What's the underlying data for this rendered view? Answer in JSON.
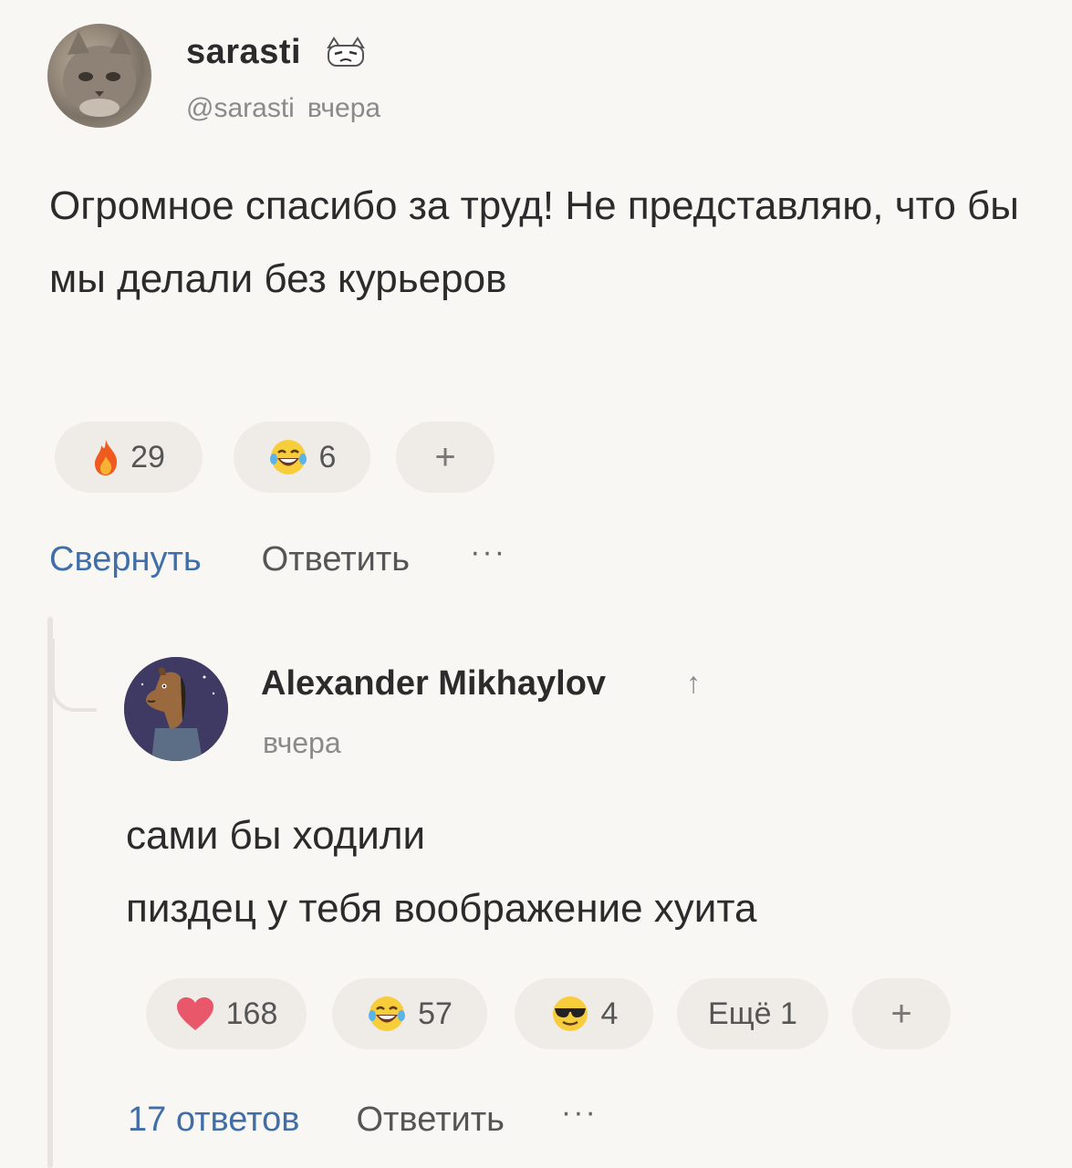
{
  "comment1": {
    "username": "sarasti",
    "handle": "@sarasti",
    "time": "вчера",
    "text": "Огромное спасибо за труд! Не представляю, что бы мы делали без курьеров",
    "reactions": [
      {
        "icon": "fire-icon",
        "count": "29"
      },
      {
        "icon": "laughing-tears-icon",
        "count": "6"
      }
    ],
    "add_reaction": "+",
    "actions": {
      "collapse": "Свернуть",
      "reply": "Ответить",
      "more": "···"
    }
  },
  "comment2": {
    "username": "Alexander Mikhaylov",
    "up_arrow": "↑",
    "time": "вчера",
    "text_line1": "сами бы ходили",
    "text_line2": "пиздец у тебя воображение хуита",
    "reactions": [
      {
        "icon": "heart-icon",
        "count": "168"
      },
      {
        "icon": "laughing-tears-icon",
        "count": "57"
      },
      {
        "icon": "sunglasses-face-icon",
        "count": "4"
      }
    ],
    "more_reactions": "Ещё 1",
    "add_reaction": "+",
    "actions": {
      "replies": "17 ответов",
      "reply": "Ответить",
      "more": "···"
    }
  },
  "colors": {
    "link_blue": "#3f6ea8",
    "background": "#f9f7f3",
    "pill": "#efece7"
  }
}
